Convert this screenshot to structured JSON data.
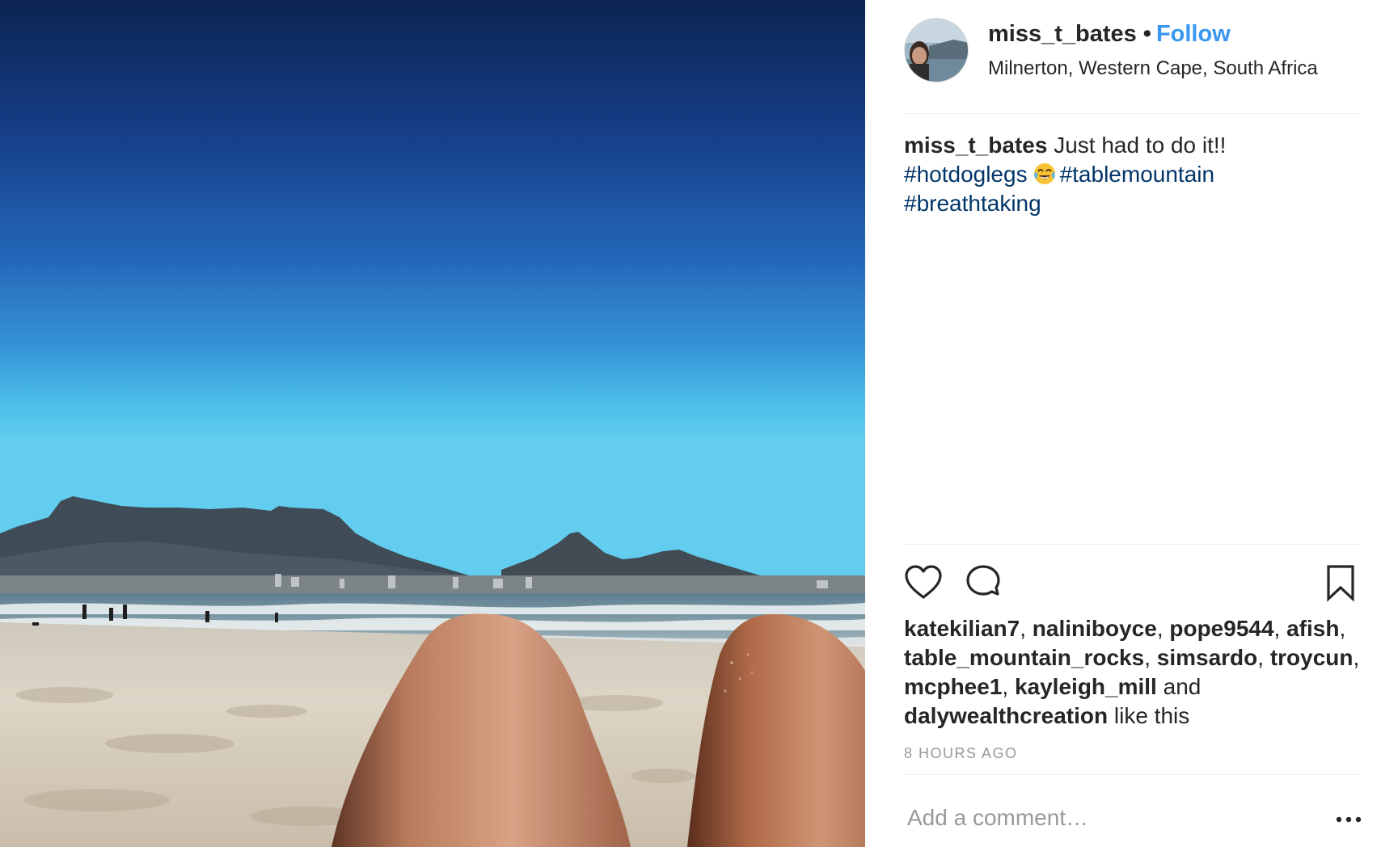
{
  "post": {
    "username": "miss_t_bates",
    "separator": "•",
    "follow_label": "Follow",
    "location": "Milnerton, Western Cape, South Africa",
    "caption": {
      "username": "miss_t_bates",
      "text": "Just had to do it!!",
      "tags": [
        "#hotdoglegs",
        "#tablemountain",
        "#breathtaking"
      ],
      "emoji": "tears-of-joy-emoji"
    },
    "likes": {
      "users": [
        "katekilian7",
        "naliniboyce",
        "pope9544",
        "afish",
        "table_mountain_rocks",
        "simsardo",
        "troycun",
        "mcphee1",
        "kayleigh_mill",
        "dalywealthcreation"
      ],
      "and": "and",
      "suffix": "like this"
    },
    "timestamp": "8 HOURS AGO",
    "comment_placeholder": "Add a comment…"
  },
  "icons": {
    "like": "heart-icon",
    "comment": "comment-icon",
    "save": "bookmark-icon",
    "more": "more-options-icon"
  },
  "colors": {
    "follow": "#3897f0",
    "hashtag": "#003569",
    "text": "#262626",
    "muted": "#999999",
    "divider": "#efefef"
  }
}
